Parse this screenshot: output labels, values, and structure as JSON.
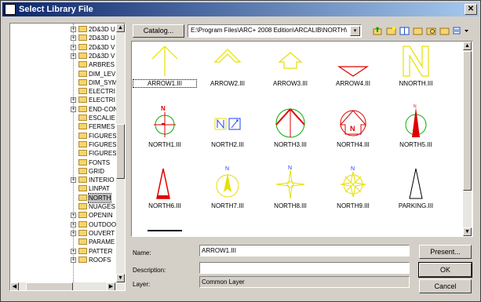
{
  "window": {
    "title": "Select Library File",
    "close_glyph": "✕"
  },
  "tree": {
    "items": [
      {
        "label": "2D&3D U",
        "expander": "+"
      },
      {
        "label": "2D&3D U",
        "expander": "+"
      },
      {
        "label": "2D&3D V",
        "expander": "+"
      },
      {
        "label": "2D&3D V",
        "expander": "+"
      },
      {
        "label": "ARBRES",
        "expander": ""
      },
      {
        "label": "DIM_LEV",
        "expander": ""
      },
      {
        "label": "DIM_SYM",
        "expander": ""
      },
      {
        "label": "ELECTRI",
        "expander": ""
      },
      {
        "label": "ELECTRI",
        "expander": "+"
      },
      {
        "label": "END-CON",
        "expander": "+"
      },
      {
        "label": "ESCALIE",
        "expander": ""
      },
      {
        "label": "FERMES",
        "expander": ""
      },
      {
        "label": "FIGURES",
        "expander": ""
      },
      {
        "label": "FIGURES",
        "expander": ""
      },
      {
        "label": "FIGURES",
        "expander": ""
      },
      {
        "label": "FONTS",
        "expander": ""
      },
      {
        "label": "GRID",
        "expander": ""
      },
      {
        "label": "INTERIO",
        "expander": "+"
      },
      {
        "label": "LINPAT",
        "expander": ""
      },
      {
        "label": "NORTH",
        "expander": "",
        "selected": true
      },
      {
        "label": "NUAGES",
        "expander": ""
      },
      {
        "label": "OPENIN",
        "expander": "+"
      },
      {
        "label": "OUTDOO",
        "expander": "+"
      },
      {
        "label": "OUVERT",
        "expander": "+"
      },
      {
        "label": "PARAME",
        "expander": ""
      },
      {
        "label": "PATTER",
        "expander": "+"
      },
      {
        "label": "ROOFS",
        "expander": "+"
      }
    ]
  },
  "toolbar": {
    "catalog_label": "Catalog...",
    "path": "E:\\Program Files\\ARC+ 2008 Edition\\ARCALIB\\NORTH\\",
    "dropdown_glyph": "▾",
    "icons": [
      "up-folder-icon",
      "new-folder-icon",
      "open-book-icon",
      "folder-open-icon",
      "folder-search-icon",
      "folder-icon",
      "view-options-icon"
    ]
  },
  "files": [
    {
      "name": "ARROW1.III",
      "icon": "arrow1",
      "selected": true
    },
    {
      "name": "ARROW2.III",
      "icon": "arrow2"
    },
    {
      "name": "ARROW3.III",
      "icon": "arrow3"
    },
    {
      "name": "ARROW4.III",
      "icon": "arrow4"
    },
    {
      "name": "NNORTH.III",
      "icon": "nnorth"
    },
    {
      "name": "NORTH1.III",
      "icon": "north1"
    },
    {
      "name": "NORTH2.III",
      "icon": "north2"
    },
    {
      "name": "NORTH3.III",
      "icon": "north3"
    },
    {
      "name": "NORTH4.III",
      "icon": "north4"
    },
    {
      "name": "NORTH5.III",
      "icon": "north5"
    },
    {
      "name": "NORTH6.III",
      "icon": "north6"
    },
    {
      "name": "NORTH7.III",
      "icon": "north7"
    },
    {
      "name": "NORTH8.III",
      "icon": "north8"
    },
    {
      "name": "NORTH9.III",
      "icon": "north9"
    },
    {
      "name": "PARKING.III",
      "icon": "parking"
    }
  ],
  "form": {
    "name_label": "Name:",
    "name_value": "ARROW1.III",
    "description_label": "Description:",
    "description_value": "",
    "layer_label": "Layer:",
    "layer_value": "Common Layer"
  },
  "buttons": {
    "present": "Present...",
    "ok": "OK",
    "cancel": "Cancel"
  },
  "colors": {
    "title_start": "#0a246a",
    "title_end": "#a6caf0",
    "yellow": "#f2e600",
    "red": "#e00000",
    "green": "#00b000",
    "blue": "#1a40ff"
  }
}
